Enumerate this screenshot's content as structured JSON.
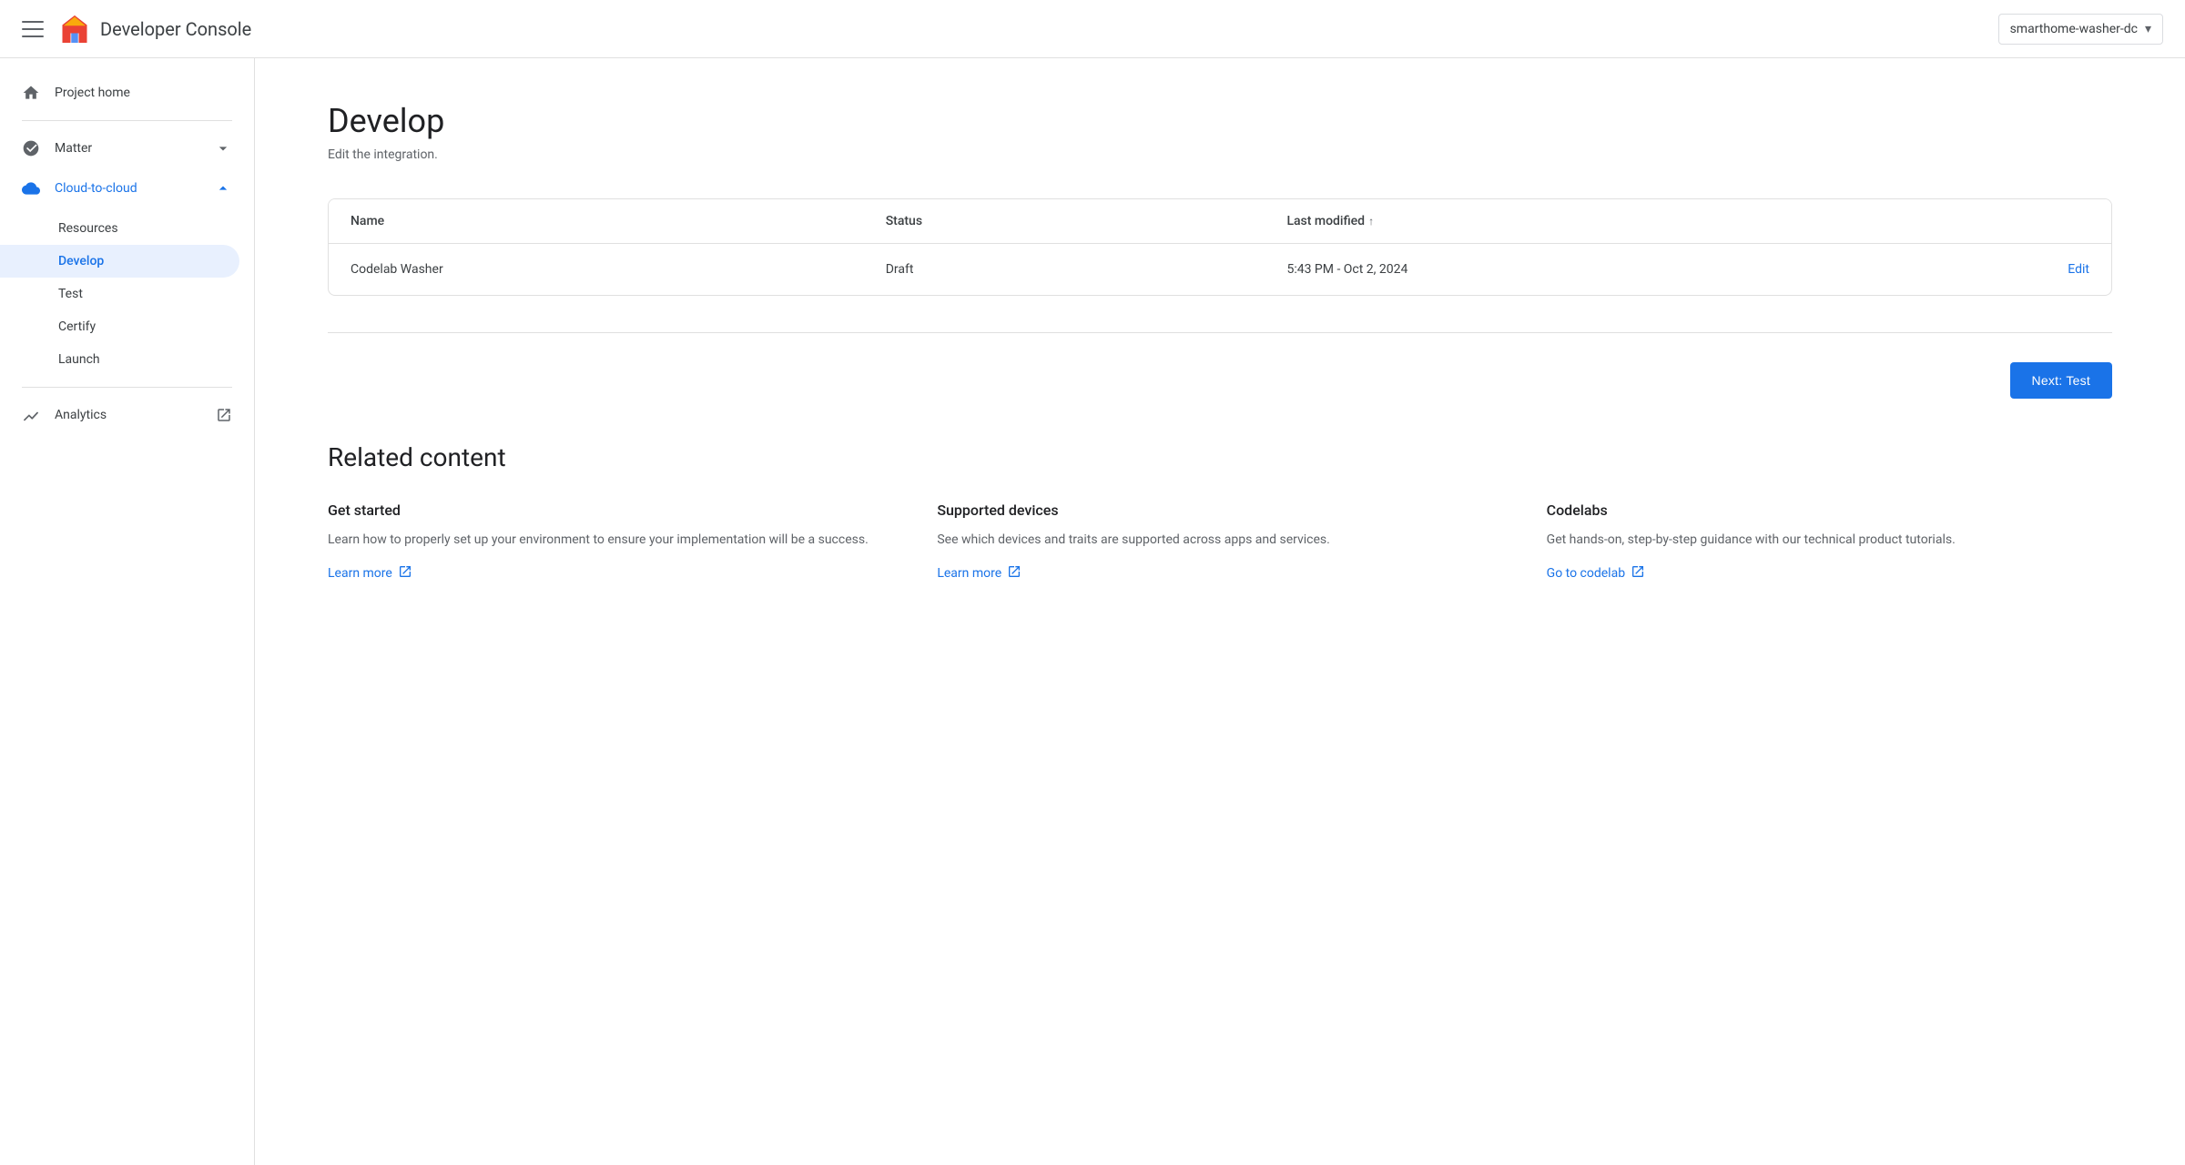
{
  "topbar": {
    "menu_label": "Menu",
    "app_title": "Developer Console",
    "project_name": "smarthome-washer-dc",
    "chevron": "▾"
  },
  "sidebar": {
    "project_home_label": "Project home",
    "matter_label": "Matter",
    "cloud_to_cloud_label": "Cloud-to-cloud",
    "resources_label": "Resources",
    "develop_label": "Develop",
    "test_label": "Test",
    "certify_label": "Certify",
    "launch_label": "Launch",
    "analytics_label": "Analytics"
  },
  "main": {
    "page_title": "Develop",
    "page_subtitle": "Edit the integration.",
    "table": {
      "col_name": "Name",
      "col_status": "Status",
      "col_last_modified": "Last modified",
      "sort_arrow": "↑",
      "rows": [
        {
          "name": "Codelab Washer",
          "status": "Draft",
          "last_modified": "5:43 PM - Oct 2, 2024",
          "action": "Edit"
        }
      ]
    },
    "next_button": "Next: Test",
    "related_title": "Related content",
    "related_cards": [
      {
        "title": "Get started",
        "desc": "Learn how to properly set up your environment to ensure your implementation will be a success.",
        "link_label": "Learn more",
        "link_icon": "↗"
      },
      {
        "title": "Supported devices",
        "desc": "See which devices and traits are supported across apps and services.",
        "link_label": "Learn more",
        "link_icon": "↗"
      },
      {
        "title": "Codelabs",
        "desc": "Get hands-on, step-by-step guidance with our technical product tutorials.",
        "link_label": "Go to codelab",
        "link_icon": "↗"
      }
    ]
  }
}
